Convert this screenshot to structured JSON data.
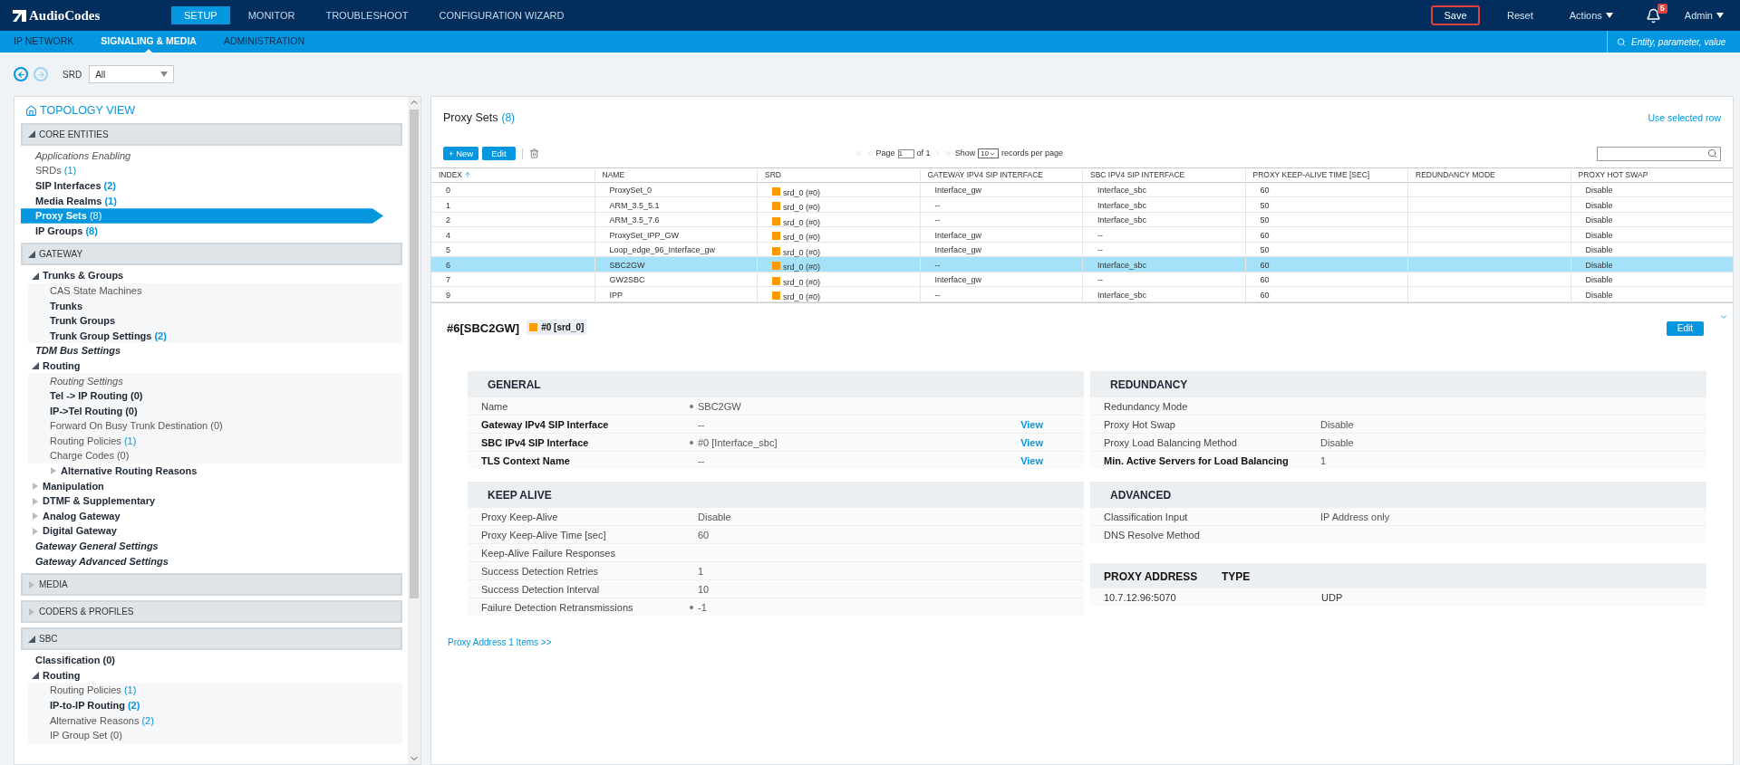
{
  "header": {
    "brand": "AudioCodes",
    "tabs": [
      {
        "label": "SETUP",
        "selected": true
      },
      {
        "label": "MONITOR",
        "selected": false
      },
      {
        "label": "TROUBLESHOOT",
        "selected": false
      },
      {
        "label": "CONFIGURATION WIZARD",
        "selected": false
      }
    ],
    "actions": {
      "save": "Save",
      "reset": "Reset",
      "actions": "Actions",
      "notifications": "5",
      "user": "Admin"
    }
  },
  "subnav": {
    "tabs": [
      {
        "label": "IP NETWORK",
        "selected": false
      },
      {
        "label": "SIGNALING & MEDIA",
        "selected": true
      },
      {
        "label": "ADMINISTRATION",
        "selected": false
      }
    ],
    "search_placeholder": "Entity, parameter, value"
  },
  "filter": {
    "label": "SRD",
    "value": "All"
  },
  "sidebar": {
    "title": "TOPOLOGY VIEW",
    "sections": [
      {
        "label": "CORE ENTITIES",
        "expanded": true,
        "items": [
          {
            "label": "Applications Enabling",
            "kind": "italic",
            "selected": false
          },
          {
            "label": "SRDs",
            "count": "(1)",
            "count_active": true,
            "kind": "normal",
            "selected": false
          },
          {
            "label": "SIP Interfaces",
            "count": "(2)",
            "count_active": true,
            "kind": "bold",
            "selected": false
          },
          {
            "label": "Media Realms",
            "count": "(1)",
            "count_active": true,
            "kind": "bold",
            "selected": false
          },
          {
            "label": "Proxy Sets",
            "count": "(8)",
            "count_active": true,
            "kind": "bold",
            "selected": true
          },
          {
            "label": "IP Groups",
            "count": "(8)",
            "count_active": true,
            "kind": "bold",
            "selected": false
          }
        ]
      },
      {
        "label": "GATEWAY",
        "expanded": true,
        "items": [
          {
            "label": "Trunks & Groups",
            "kind": "bold",
            "selected": false,
            "expanded": true,
            "children": [
              {
                "label": "CAS State Machines",
                "kind": "normal",
                "selected": false
              },
              {
                "label": "Trunks",
                "kind": "bold",
                "selected": false
              },
              {
                "label": "Trunk Groups",
                "kind": "bold",
                "selected": false
              },
              {
                "label": "Trunk Group Settings",
                "count": "(2)",
                "count_active": true,
                "kind": "bold",
                "selected": false
              }
            ]
          },
          {
            "label": "TDM Bus Settings",
            "kind": "bolditalic",
            "selected": false
          },
          {
            "label": "Routing",
            "kind": "bold",
            "selected": false,
            "expanded": true,
            "children": [
              {
                "label": "Routing Settings",
                "kind": "italic",
                "selected": false
              },
              {
                "label": "Tel -> IP Routing",
                "count": "(0)",
                "count_active": false,
                "kind": "bold",
                "selected": false
              },
              {
                "label": "IP->Tel Routing",
                "count": "(0)",
                "count_active": false,
                "kind": "bold",
                "selected": false
              },
              {
                "label": "Forward On Busy Trunk Destination",
                "count": "(0)",
                "count_active": false,
                "kind": "normal",
                "selected": false
              },
              {
                "label": "Routing Policies",
                "count": "(1)",
                "count_active": true,
                "kind": "normal",
                "selected": false
              },
              {
                "label": "Charge Codes",
                "count": "(0)",
                "count_active": false,
                "kind": "normal",
                "selected": false
              },
              {
                "label": "Alternative Routing Reasons",
                "kind": "bold",
                "selected": false,
                "expanded": false
              }
            ]
          },
          {
            "label": "Manipulation",
            "kind": "bold",
            "selected": false,
            "expanded": false
          },
          {
            "label": "DTMF & Supplementary",
            "kind": "bold",
            "selected": false,
            "expanded": false
          },
          {
            "label": "Analog Gateway",
            "kind": "bold",
            "selected": false,
            "expanded": false
          },
          {
            "label": "Digital Gateway",
            "kind": "bold",
            "selected": false,
            "expanded": false
          },
          {
            "label": "Gateway General Settings",
            "kind": "bolditalic",
            "selected": false
          },
          {
            "label": "Gateway Advanced Settings",
            "kind": "bolditalic",
            "selected": false
          }
        ]
      },
      {
        "label": "MEDIA",
        "expanded": false
      },
      {
        "label": "CODERS & PROFILES",
        "expanded": false
      },
      {
        "label": "SBC",
        "expanded": true,
        "items": [
          {
            "label": "Classification",
            "count": "(0)",
            "count_active": false,
            "kind": "bold",
            "selected": false
          },
          {
            "label": "Routing",
            "kind": "bold",
            "selected": false,
            "expanded": true,
            "children": [
              {
                "label": "Routing Policies",
                "count": "(1)",
                "count_active": true,
                "kind": "normal",
                "selected": false
              },
              {
                "label": "IP-to-IP Routing",
                "count": "(2)",
                "count_active": true,
                "kind": "bold",
                "selected": false
              },
              {
                "label": "Alternative Reasons",
                "count": "(2)",
                "count_active": true,
                "kind": "normal",
                "selected": false
              },
              {
                "label": "IP Group Set",
                "count": "(0)",
                "count_active": false,
                "kind": "normal",
                "selected": false
              }
            ]
          }
        ]
      }
    ]
  },
  "table_panel": {
    "title": "Proxy Sets",
    "count": "(8)",
    "use_selected_row": "Use selected row",
    "new_button": "+ New",
    "edit_button": "Edit",
    "pager": {
      "page_label": "Page",
      "page": "1",
      "of": "of 1",
      "show": "Show",
      "per_page": "10",
      "records": "records per page"
    },
    "columns": [
      "INDEX",
      "NAME",
      "SRD",
      "GATEWAY IPV4 SIP INTERFACE",
      "SBC IPV4 SIP INTERFACE",
      "PROXY KEEP-ALIVE TIME [SEC]",
      "REDUNDANCY MODE",
      "PROXY HOT SWAP"
    ],
    "rows": [
      {
        "selected": false,
        "cells": [
          "0",
          "ProxySet_0",
          "srd_0 (#0)",
          "Interface_gw",
          "Interface_sbc",
          "60",
          "",
          "Disable"
        ]
      },
      {
        "selected": false,
        "cells": [
          "1",
          "ARM_3.5_5.1",
          "srd_0 (#0)",
          "--",
          "Interface_sbc",
          "50",
          "",
          "Disable"
        ]
      },
      {
        "selected": false,
        "cells": [
          "2",
          "ARM_3.5_7.6",
          "srd_0 (#0)",
          "--",
          "Interface_sbc",
          "50",
          "",
          "Disable"
        ]
      },
      {
        "selected": false,
        "cells": [
          "4",
          "ProxySet_IPP_GW",
          "srd_0 (#0)",
          "Interface_gw",
          "--",
          "60",
          "",
          "Disable"
        ]
      },
      {
        "selected": false,
        "cells": [
          "5",
          "Loop_edge_96_Interface_gw",
          "srd_0 (#0)",
          "Interface_gw",
          "--",
          "50",
          "",
          "Disable"
        ]
      },
      {
        "selected": true,
        "cells": [
          "6",
          "SBC2GW",
          "srd_0 (#0)",
          "--",
          "Interface_sbc",
          "60",
          "",
          "Disable"
        ]
      },
      {
        "selected": false,
        "cells": [
          "7",
          "GW2SBC",
          "srd_0 (#0)",
          "Interface_gw",
          "--",
          "60",
          "",
          "Disable"
        ]
      },
      {
        "selected": false,
        "cells": [
          "9",
          "IPP",
          "srd_0 (#0)",
          "--",
          "Interface_sbc",
          "60",
          "",
          "Disable"
        ]
      }
    ]
  },
  "detail": {
    "title": "#6[SBC2GW]",
    "tag": "#0 [srd_0]",
    "edit_button": "Edit",
    "left": [
      {
        "title": "GENERAL",
        "rows": [
          {
            "label": "Name",
            "value": "SBC2GW",
            "bold": false,
            "dot": true
          },
          {
            "label": "Gateway IPv4 SIP Interface",
            "value": "--",
            "bold": true,
            "dot": false,
            "link": "View"
          },
          {
            "label": "SBC IPv4 SIP Interface",
            "value": "#0 [Interface_sbc]",
            "bold": true,
            "dot": true,
            "link": "View"
          },
          {
            "label": "TLS Context Name",
            "value": "--",
            "bold": true,
            "dot": false,
            "link": "View"
          }
        ]
      },
      {
        "title": "KEEP ALIVE",
        "rows": [
          {
            "label": "Proxy Keep-Alive",
            "value": "Disable",
            "bold": false,
            "dot": false
          },
          {
            "label": "Proxy Keep-Alive Time [sec]",
            "value": "60",
            "bold": false,
            "dot": false
          },
          {
            "label": "Keep-Alive Failure Responses",
            "bold": false,
            "dot": false
          },
          {
            "label": "Success Detection Retries",
            "value": "1",
            "bold": false,
            "dot": false
          },
          {
            "label": "Success Detection Interval",
            "value": "10",
            "bold": false,
            "dot": false
          },
          {
            "label": "Failure Detection Retransmissions",
            "value": "-1",
            "bold": false,
            "dot": true
          }
        ]
      }
    ],
    "right": [
      {
        "title": "REDUNDANCY",
        "rows": [
          {
            "label": "Redundancy Mode",
            "bold": false,
            "dot": false
          },
          {
            "label": "Proxy Hot Swap",
            "value": "Disable",
            "bold": false,
            "dot": false
          },
          {
            "label": "Proxy Load Balancing Method",
            "value": "Disable",
            "bold": false,
            "dot": false
          },
          {
            "label": "Min. Active Servers for Load Balancing",
            "value": "1",
            "bold": true,
            "dot": false
          }
        ]
      },
      {
        "title": "ADVANCED",
        "rows": [
          {
            "label": "Classification Input",
            "value": "IP Address only",
            "bold": false,
            "dot": false
          },
          {
            "label": "DNS Resolve Method",
            "bold": false,
            "dot": false
          }
        ]
      }
    ],
    "proxy_address": {
      "columns": [
        "PROXY ADDRESS",
        "TYPE"
      ],
      "rows": [
        [
          "10.7.12.96:5070",
          "UDP"
        ]
      ]
    },
    "footer_link": "Proxy Address 1 Items >>"
  }
}
